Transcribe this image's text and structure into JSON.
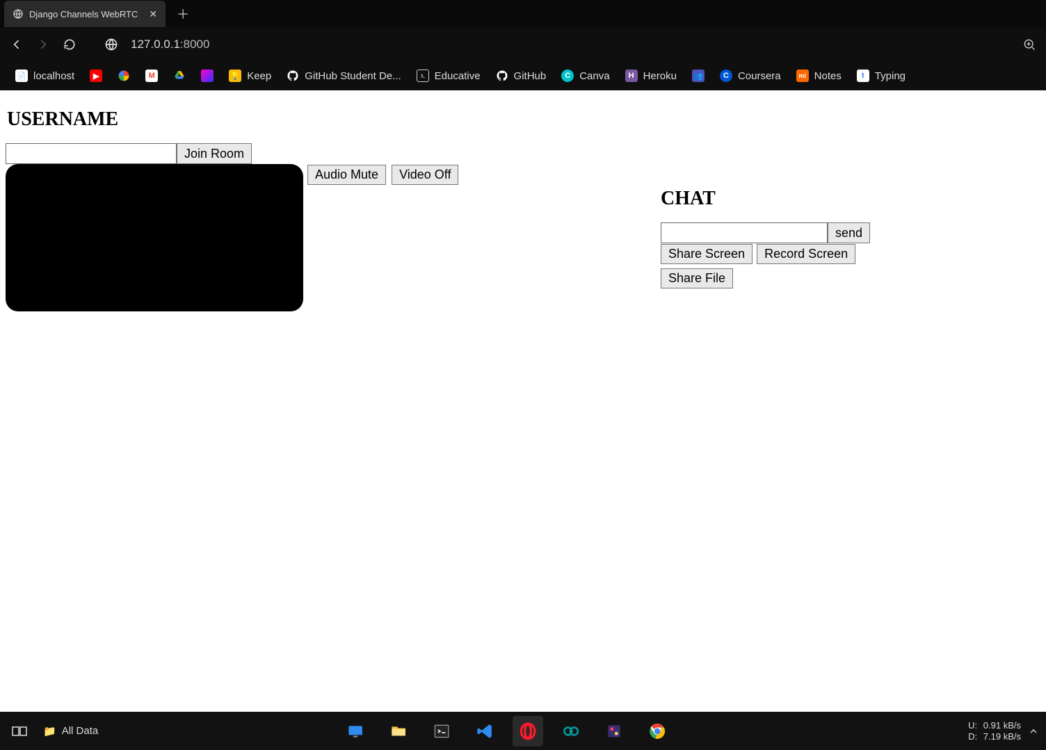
{
  "browser": {
    "tab_title": "Django Channels WebRTC",
    "url_host": "127.0.0.1",
    "url_port": ":8000"
  },
  "bookmarks": [
    {
      "label": "localhost",
      "icon": "file-icon-white"
    },
    {
      "label": "",
      "icon": "youtube-icon"
    },
    {
      "label": "",
      "icon": "photos-icon"
    },
    {
      "label": "",
      "icon": "gmail-icon"
    },
    {
      "label": "",
      "icon": "drive-icon"
    },
    {
      "label": "",
      "icon": "square-gradient-icon"
    },
    {
      "label": "Keep",
      "icon": "keep-icon"
    },
    {
      "label": "GitHub Student De...",
      "icon": "github-icon"
    },
    {
      "label": "Educative",
      "icon": "educative-icon"
    },
    {
      "label": "GitHub",
      "icon": "github-icon"
    },
    {
      "label": "Canva",
      "icon": "canva-icon"
    },
    {
      "label": "Heroku",
      "icon": "heroku-icon"
    },
    {
      "label": "",
      "icon": "teams-icon"
    },
    {
      "label": "Coursera",
      "icon": "coursera-icon"
    },
    {
      "label": "Notes",
      "icon": "mi-icon"
    },
    {
      "label": "Typing",
      "icon": "typing-icon"
    }
  ],
  "page": {
    "username_heading": "USERNAME",
    "join_button": "Join Room",
    "audio_mute_button": "Audio Mute",
    "video_off_button": "Video Off",
    "chat_heading": "CHAT",
    "send_button": "send",
    "share_screen_button": "Share Screen",
    "record_screen_button": "Record Screen",
    "share_file_button": "Share File",
    "username_value": "",
    "chat_value": ""
  },
  "taskbar": {
    "folder_label": "All Data",
    "net_up_label": "U:",
    "net_up_value": "0.91 kB/s",
    "net_down_label": "D:",
    "net_down_value": "7.19 kB/s"
  },
  "icon_colors": {
    "youtube": "#ff0000",
    "photos": "#4285f4",
    "gmail": "#ea4335",
    "drive": "#fbbc04",
    "keep": "#fbbc04",
    "canva": "#00c4cc",
    "heroku": "#79589f",
    "coursera": "#0056d2",
    "mi": "#ff6700",
    "typing": "#3b82f6"
  }
}
